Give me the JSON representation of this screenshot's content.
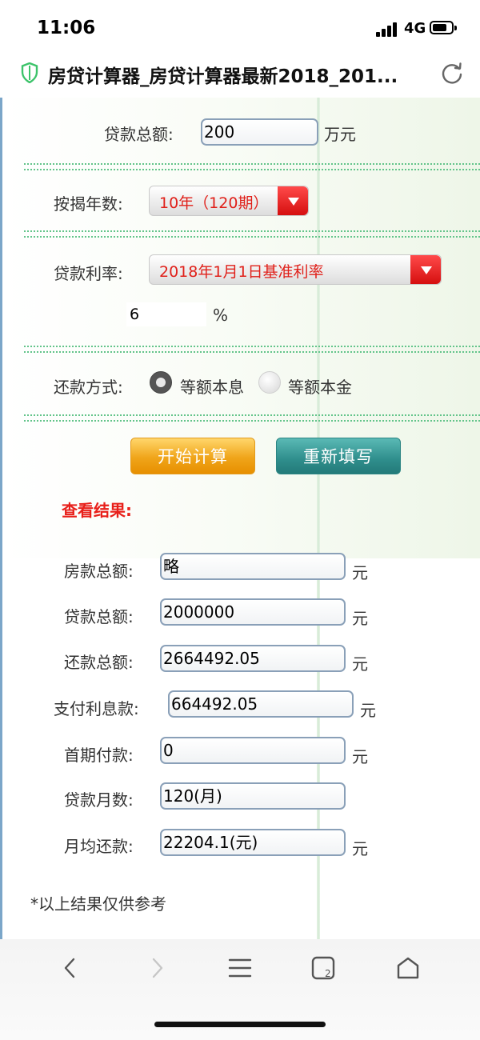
{
  "status": {
    "time": "11:06",
    "network": "4G"
  },
  "browser": {
    "title": "房贷计算器_房贷计算器最新2018_201..."
  },
  "form": {
    "loan_total_label": "贷款总额:",
    "loan_total_value": "200",
    "loan_total_unit": "万元",
    "mortgage_years_label": "按揭年数:",
    "mortgage_years_value": "10年（120期）",
    "interest_rate_label": "贷款利率:",
    "interest_rate_value": "2018年1月1日基准利率",
    "rate_number": "6",
    "rate_unit": "%",
    "repay_method_label": "还款方式:",
    "repay_options": [
      {
        "label": "等额本息",
        "selected": true
      },
      {
        "label": "等额本金",
        "selected": false
      }
    ],
    "calc_button": "开始计算",
    "reset_button": "重新填写"
  },
  "results": {
    "heading": "查看结果:",
    "house_total_label": "房款总额:",
    "house_total_value": "略",
    "house_total_unit": "元",
    "loan_total_label": "贷款总额:",
    "loan_total_value": "2000000",
    "loan_total_unit": "元",
    "repay_total_label": "还款总额:",
    "repay_total_value": "2664492.05",
    "repay_total_unit": "元",
    "interest_label": "支付利息款:",
    "interest_value": "664492.05",
    "interest_unit": "元",
    "down_payment_label": "首期付款:",
    "down_payment_value": "0",
    "down_payment_unit": "元",
    "loan_months_label": "贷款月数:",
    "loan_months_value": "120(月)",
    "monthly_label": "月均还款:",
    "monthly_value": "22204.1(元)",
    "monthly_unit": "元"
  },
  "note": "*以上结果仅供参考",
  "colors": {
    "accent_red": "#e8201a",
    "calc_orange": "#f0a51a",
    "reset_teal": "#2f8e8c",
    "dotted_green": "#63c48a"
  }
}
